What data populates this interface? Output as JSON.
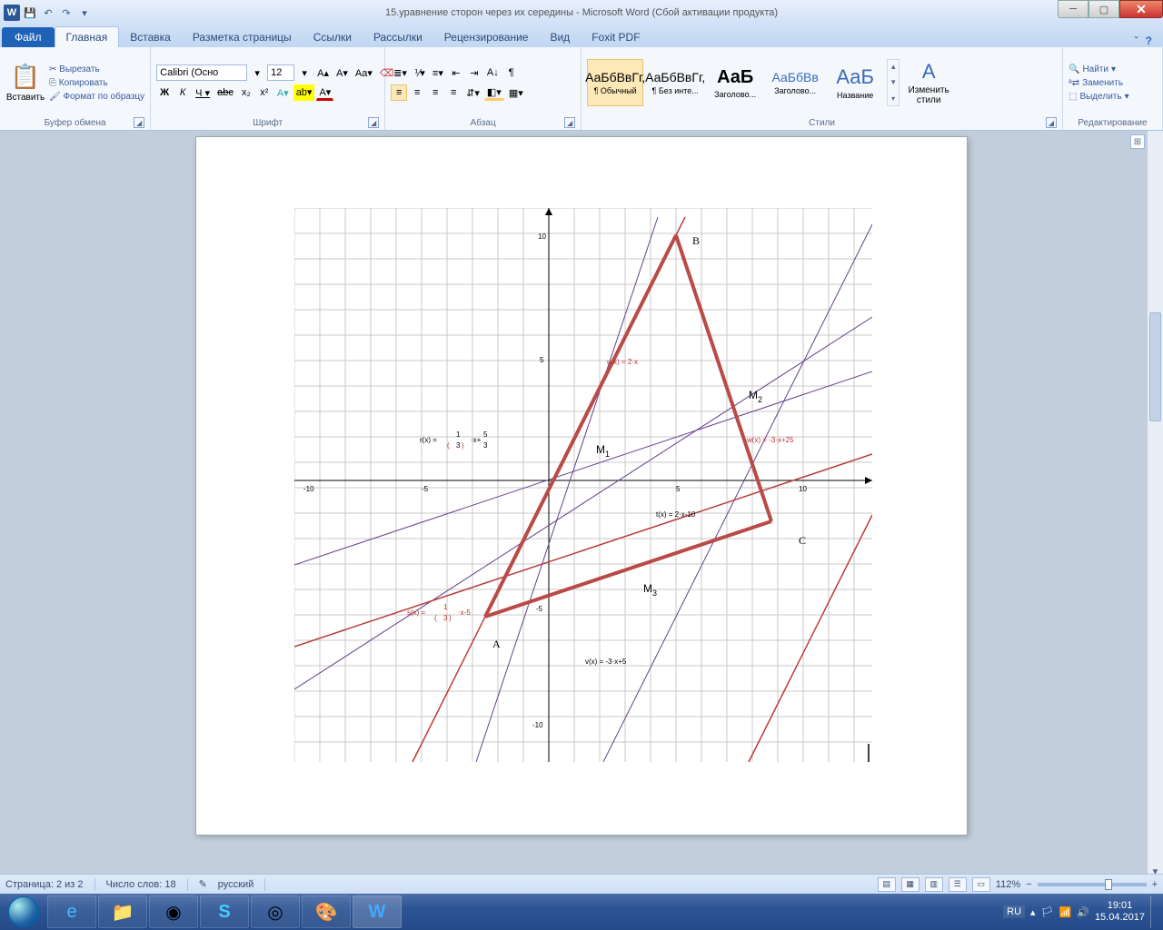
{
  "title": "15.уравнение сторон через их середины - Microsoft Word (Сбой активации продукта)",
  "tabs": {
    "file": "Файл",
    "items": [
      "Главная",
      "Вставка",
      "Разметка страницы",
      "Ссылки",
      "Рассылки",
      "Рецензирование",
      "Вид",
      "Foxit PDF"
    ],
    "active": 0
  },
  "ribbon": {
    "clipboard": {
      "label": "Буфер обмена",
      "paste": "Вставить",
      "cut": "Вырезать",
      "copy": "Копировать",
      "formatp": "Формат по образцу"
    },
    "font": {
      "label": "Шрифт",
      "name": "Calibri (Осно",
      "size": "12"
    },
    "paragraph": {
      "label": "Абзац"
    },
    "styles": {
      "label": "Стили",
      "items": [
        {
          "preview": "АаБбВвГг,",
          "name": "¶ Обычный"
        },
        {
          "preview": "АаБбВвГг,",
          "name": "¶ Без инте..."
        },
        {
          "preview": "АаБ",
          "name": "Заголово..."
        },
        {
          "preview": "АаБбВв",
          "name": "Заголово..."
        },
        {
          "preview": "АаБ",
          "name": "Название"
        }
      ],
      "change": "Изменить стили"
    },
    "editing": {
      "label": "Редактирование",
      "find": "Найти",
      "replace": "Заменить",
      "select": "Выделить"
    }
  },
  "status": {
    "page": "Страница: 2 из 2",
    "words": "Число слов: 18",
    "lang": "русский",
    "zoom": "112%"
  },
  "tray": {
    "lang": "RU",
    "time": "19:01",
    "date": "15.04.2017"
  },
  "graph": {
    "points": {
      "A": "A",
      "B": "B",
      "C": "C",
      "M1": "M",
      "M2": "M",
      "M3": "M"
    },
    "eq": {
      "u": "u(x) = 2·x",
      "w": "w(x) = -3·x+25",
      "t": "t(x) = 2·x-10",
      "v": "v(x) = -3·x+5",
      "r": "r(x) =",
      "rsuf": "·x+",
      "s": "s(x) =",
      "ssuf": "·x-5",
      "frac_top": "1",
      "frac_bot": "3",
      "r2_top": "5",
      "r2_bot": "3"
    }
  }
}
